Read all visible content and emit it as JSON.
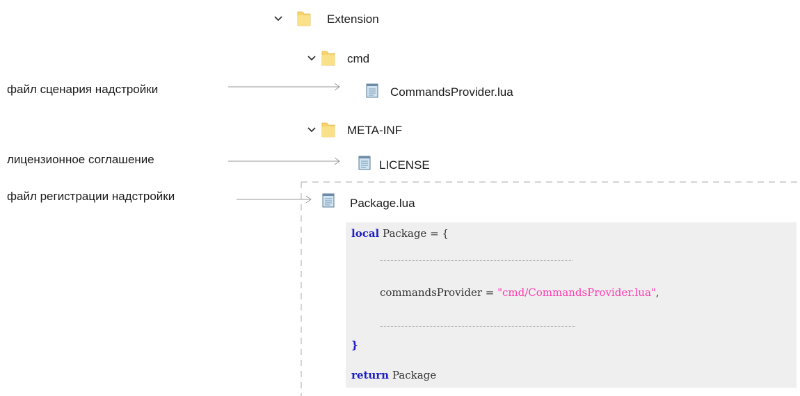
{
  "tree": {
    "extension_label": "Extension",
    "cmd_label": "cmd",
    "commands_provider_label": "CommandsProvider.lua",
    "meta_inf_label": "META-INF",
    "license_label": "LICENSE",
    "package_label": "Package.lua"
  },
  "annotations": {
    "script_file": "файл сценария надстройки",
    "license_agreement": "лицензионное соглашение",
    "registration_file": "файл регистрации надстройки"
  },
  "code": {
    "line1_kw": "local",
    "line1_rest": " Package = {",
    "line3_key": "commandsProvider = ",
    "line3_str": "\"cmd/CommandsProvider.lua\"",
    "line3_comma": ",",
    "line5": "}",
    "line6_kw": "return",
    "line6_rest": " Package"
  },
  "colors": {
    "keyword": "#1f1fc4",
    "string": "#ff3ab0",
    "code_bg": "#efefef",
    "folder": "#f7d36b"
  }
}
